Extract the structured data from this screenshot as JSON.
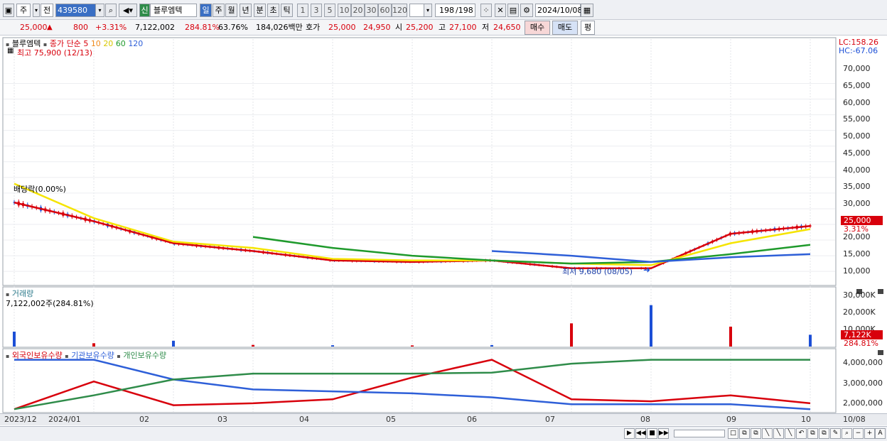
{
  "toolbar": {
    "mode_label": "주",
    "prev_label": "전",
    "code_value": "439580",
    "new_badge": "신",
    "stock_name": "블루엠텍",
    "periods": [
      "일",
      "주",
      "월",
      "년",
      "분",
      "초",
      "틱"
    ],
    "intervals": [
      "1",
      "3",
      "5",
      "10",
      "20",
      "30",
      "60",
      "120"
    ],
    "count": "198",
    "total": "/198",
    "date": "2024/10/08"
  },
  "quote": {
    "price": "25,000",
    "change": "800",
    "change_pct": "+3.31%",
    "volume": "7,122,002",
    "volume_pct": "284.81%",
    "turnover": "63.76%",
    "amount": "184,026백만",
    "bid_label": "호가",
    "bid1": "25,000",
    "bid2": "24,950",
    "open_label": "시",
    "open": "25,200",
    "high_label": "고",
    "high": "27,100",
    "low_label": "저",
    "low": "24,650",
    "buy_label": "매수",
    "sell_label": "매도",
    "eval_label": "평"
  },
  "price_panel": {
    "name": "블루엠텍",
    "ma_title": "종가 단순",
    "ma_periods": [
      "5",
      "10",
      "20",
      "60",
      "120"
    ],
    "high_note": "최고 75,900 (12/13)",
    "low_note": "최저 9,680 (08/05)",
    "mid_note": "배당락(0.00%)",
    "lc": "LC:158.26",
    "hc": "HC:-67.06",
    "y_ticks": [
      "70,000",
      "65,000",
      "60,000",
      "55,000",
      "50,000",
      "45,000",
      "40,000",
      "35,000",
      "30,000",
      "25,000",
      "20,000",
      "15,000",
      "10,000"
    ],
    "last_price_tag": "25,000",
    "last_pct_tag": "3.31%"
  },
  "volume_panel": {
    "title": "거래량",
    "note": "7,122,002주(284.81%)",
    "y_ticks": [
      "30,000K",
      "20,000K",
      "10,000K"
    ],
    "tag1": "7,122K",
    "tag2": "284.81%"
  },
  "holding_panel": {
    "titles": [
      "외국인보유수량",
      "기관보유수량",
      "개인보유수량"
    ],
    "y_ticks": [
      "4,000,000",
      "3,000,000",
      "2,000,000"
    ]
  },
  "x_axis": {
    "labels": [
      "2023/12",
      "2024/01",
      "02",
      "03",
      "04",
      "05",
      "06",
      "07",
      "08",
      "09",
      "10",
      "10/08"
    ]
  },
  "colors": {
    "up": "#d8000c",
    "down": "#1c4fd6",
    "ma5": "#d8000c",
    "ma10": "#f08a1c",
    "ma20": "#f5e400",
    "ma60": "#1f9a2c",
    "ma120": "#2e5fd8",
    "foreign": "#d8000c",
    "institution": "#2e5fd8",
    "individual": "#2f8c4a"
  },
  "chart_data": [
    {
      "type": "line",
      "title": "블루엠텍",
      "x": [
        "2023/12",
        "2024/01",
        "02",
        "03",
        "04",
        "05",
        "06",
        "07",
        "08",
        "09",
        "10"
      ],
      "series": [
        {
          "name": "5",
          "values": [
            32000,
            26000,
            19000,
            16500,
            13500,
            13000,
            13500,
            11000,
            11000,
            22000,
            24500
          ]
        },
        {
          "name": "20",
          "values": [
            38000,
            27000,
            19500,
            17500,
            14000,
            13500,
            13500,
            12500,
            12000,
            19000,
            23500
          ]
        },
        {
          "name": "60",
          "values": [
            null,
            null,
            null,
            21000,
            17500,
            15000,
            13500,
            12500,
            13000,
            15500,
            18500
          ]
        },
        {
          "name": "120",
          "values": [
            null,
            null,
            null,
            null,
            null,
            null,
            16500,
            15000,
            13000,
            14500,
            15500
          ]
        }
      ],
      "ylim": [
        8000,
        76000
      ]
    },
    {
      "type": "bar",
      "title": "거래량",
      "categories": [
        "2023/12",
        "2024/01",
        "02",
        "03",
        "04",
        "05",
        "06",
        "07",
        "08",
        "09",
        "10"
      ],
      "values": [
        9000,
        2000,
        3500,
        1000,
        800,
        700,
        900,
        14000,
        25000,
        12000,
        7122
      ],
      "ylim": [
        0,
        33000
      ]
    },
    {
      "type": "line",
      "x": [
        "2023/12",
        "2024/01",
        "02",
        "03",
        "04",
        "05",
        "06",
        "07",
        "08",
        "09",
        "10"
      ],
      "series": [
        {
          "name": "외국인보유수량",
          "values": [
            1700000,
            3100000,
            1900000,
            2000000,
            2200000,
            3300000,
            4200000,
            2200000,
            2100000,
            2400000,
            2000000
          ]
        },
        {
          "name": "기관보유수량",
          "values": [
            4200000,
            4200000,
            3200000,
            2700000,
            2600000,
            2500000,
            2300000,
            1950000,
            1950000,
            1950000,
            1700000
          ]
        },
        {
          "name": "개인보유수량",
          "values": [
            1700000,
            2400000,
            3200000,
            3500000,
            3500000,
            3500000,
            3550000,
            4000000,
            4200000,
            4200000,
            4200000
          ]
        }
      ],
      "ylim": [
        1600000,
        4400000
      ]
    }
  ]
}
